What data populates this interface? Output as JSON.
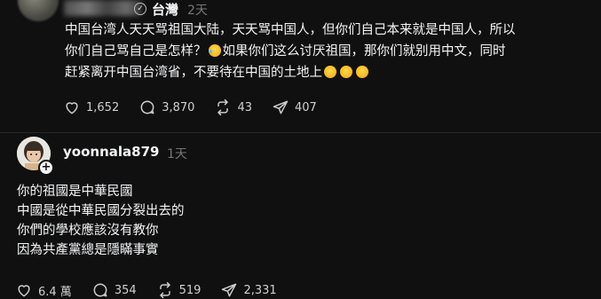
{
  "post1": {
    "location": "台灣",
    "time": "2天",
    "lines": [
      "中国台湾人天天骂祖国大陆，天天骂中国人，但你们自己本来就是中国人，所以",
      "你们自己骂自己是怎样？",
      "如果你们这么讨厌祖国，那你们就别用中文，同时",
      "赶紧离开中国台湾省，不要待在中国的土地上"
    ],
    "likes": "1,652",
    "replies": "3,870",
    "reposts": "43",
    "shares": "407"
  },
  "post2": {
    "username": "yoonnala879",
    "time": "1天",
    "lines": [
      "你的祖國是中華民國",
      "中國是從中華民國分裂出去的",
      "你們的學校應該沒有教你",
      "因為共產黨總是隱瞞事實"
    ],
    "likes": "6.4 萬",
    "replies": "354",
    "reposts": "519",
    "shares": "2,331"
  },
  "icons": {
    "like": "heart-icon",
    "reply": "comment-icon",
    "repost": "repost-icon",
    "share": "send-icon"
  },
  "colors": {
    "background": "#101010",
    "text": "#f3f5f7",
    "muted": "#777777"
  }
}
